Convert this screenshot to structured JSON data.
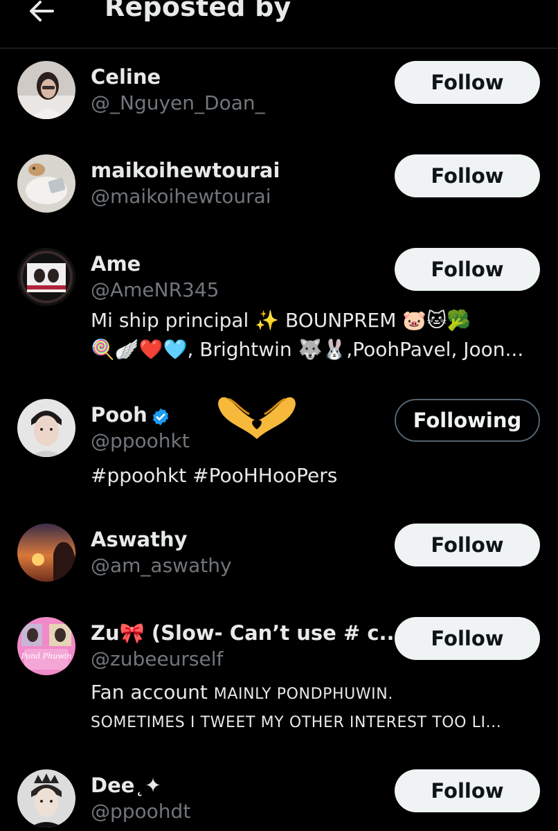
{
  "header": {
    "title": "Reposted by"
  },
  "users": [
    {
      "name": "Celine",
      "handle": "@_Nguyen_Doan_",
      "button": "Follow",
      "avatar_icon": "person-photo-avatar"
    },
    {
      "name": "maikoihewtourai",
      "handle": "@maikoihewtourai",
      "button": "Follow",
      "avatar_icon": "cat-photo-avatar"
    },
    {
      "name": "Ame",
      "handle": "@AmeNR345",
      "button": "Follow",
      "bio_line1": "Mi ship principal ✨ BOUNPREM 🐷🐱🥦",
      "bio_line2": "🍭🪽❤️🩵, Brightwin 🐺🐰,PoohPavel, Joon...",
      "avatar_icon": "couple-photo-avatar"
    },
    {
      "name": "Pooh",
      "handle": "@ppoohkt",
      "button": "Following",
      "verified": true,
      "bio_line1": "#ppoohkt #PooHHooPers",
      "avatar_icon": "man-photo-avatar",
      "decor_icon": "heart-hands-icon"
    },
    {
      "name": "Aswathy",
      "handle": "@am_aswathy",
      "button": "Follow",
      "avatar_icon": "sunset-art-avatar"
    },
    {
      "name": "Zu🎀 (Slow- Can’t use # c...",
      "handle": "@zubeeurself",
      "button": "Follow",
      "bio_line1_a": "Fan account ",
      "bio_line1_b": "MAINLY PONDPHUWIN.",
      "bio_line2": "SOMETIMES I TWEET MY OTHER INTEREST TOO LI...",
      "avatar_text": "Pond Phuwin",
      "avatar_icon": "pink-collage-avatar"
    },
    {
      "name": "Dee",
      "name_suffix": "˛✦",
      "handle": "@ppoohdt",
      "button": "Follow",
      "avatar_icon": "crown-man-avatar"
    }
  ],
  "colors": {
    "background": "#000000",
    "primary_text": "#e7e9ea",
    "secondary_text": "#71767b",
    "follow_button_bg": "#eff3f4",
    "verified_blue": "#1d9bf0"
  }
}
